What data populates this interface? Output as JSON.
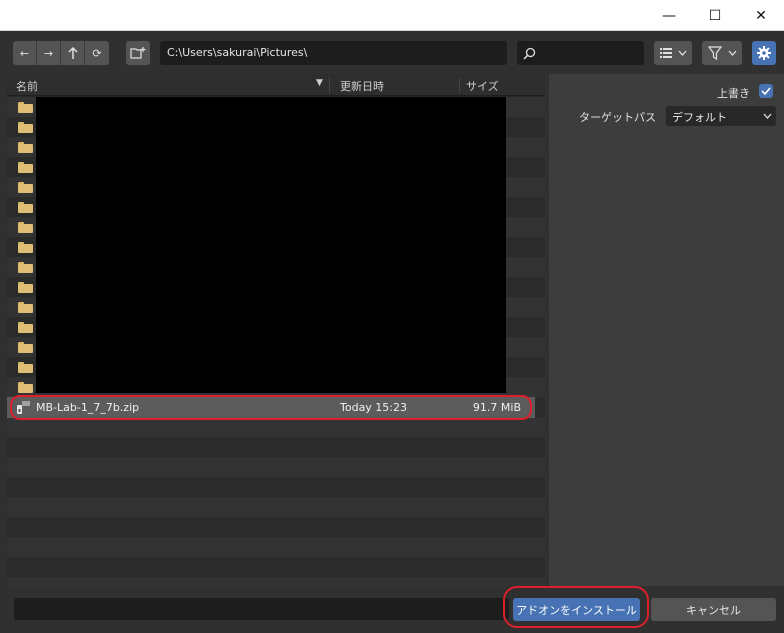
{
  "window": {
    "minimize_glyph": "—",
    "maximize_glyph": "☐",
    "close_glyph": "✕"
  },
  "toolbar": {
    "back_glyph": "←",
    "forward_glyph": "→",
    "parent_glyph": "⮤",
    "refresh_glyph": "⟳",
    "path": "C:\\Users\\sakurai\\Pictures\\",
    "search_value": ""
  },
  "columns": {
    "name": "名前",
    "sort_glyph": "▼",
    "date": "更新日時",
    "size": "サイズ"
  },
  "file": {
    "name": "MB-Lab-1_7_7b.zip",
    "date": "Today 15:23",
    "size": "91.7 MiB",
    "icon": "zip-file-icon"
  },
  "side": {
    "overwrite_label": "上書き",
    "overwrite_checked": true,
    "target_label": "ターゲットパス",
    "target_value": "デフォルト"
  },
  "bottom": {
    "filename_value": "",
    "install_label": "アドオンをインストール",
    "cancel_label": "キャンセル"
  },
  "colors": {
    "accent": "#4772b3",
    "highlight": "#d9202b",
    "folder": "#e0bd74"
  }
}
